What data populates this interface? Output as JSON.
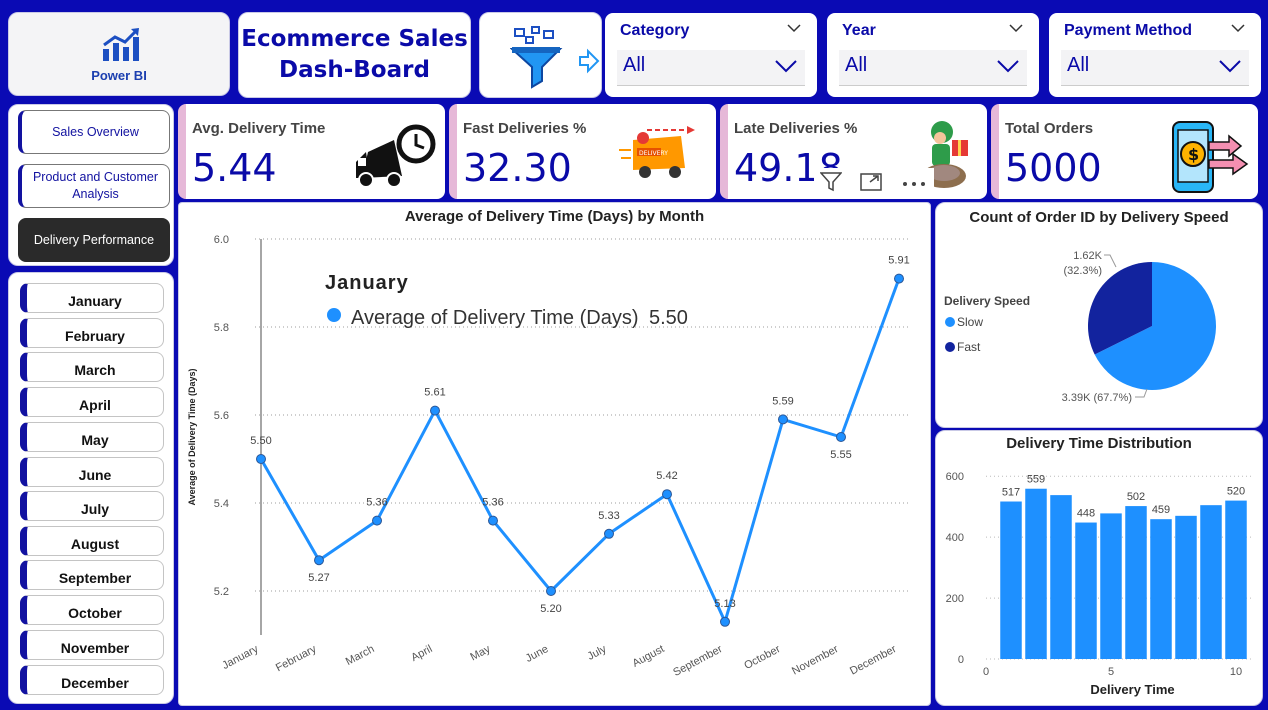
{
  "app": {
    "logo_text": "Power BI",
    "title_line1": "Ecommerce Sales",
    "title_line2": "Dash-Board"
  },
  "slicers": [
    {
      "label": "Category",
      "value": "All"
    },
    {
      "label": "Year",
      "value": "All"
    },
    {
      "label": "Payment Method",
      "value": "All"
    }
  ],
  "nav": [
    {
      "label": "Sales Overview"
    },
    {
      "label": "Product and Customer Analysis"
    },
    {
      "label": "Delivery Performance"
    }
  ],
  "months": [
    "January",
    "February",
    "March",
    "April",
    "May",
    "June",
    "July",
    "August",
    "September",
    "October",
    "November",
    "December"
  ],
  "kpis": [
    {
      "title": "Avg. Delivery Time",
      "value": "5.44",
      "icon": "truck-clock-icon"
    },
    {
      "title": "Fast Deliveries %",
      "value": "32.30",
      "icon": "delivery-van-icon"
    },
    {
      "title": "Late Deliveries %",
      "value": "49.18",
      "icon": "turtle-courier-icon"
    },
    {
      "title": "Total Orders",
      "value": "5000",
      "icon": "phone-payment-icon"
    }
  ],
  "tooltip": {
    "month": "January",
    "series": "Average of Delivery Time (Days)",
    "value": "5.50"
  },
  "chart_data": [
    {
      "type": "line",
      "title": "Average of Delivery Time (Days) by Month",
      "xlabel": "",
      "ylabel": "Average of Delivery Time (Days)",
      "categories": [
        "January",
        "February",
        "March",
        "April",
        "May",
        "June",
        "July",
        "August",
        "September",
        "October",
        "November",
        "December"
      ],
      "values": [
        5.5,
        5.27,
        5.36,
        5.61,
        5.36,
        5.2,
        5.33,
        5.42,
        5.13,
        5.59,
        5.55,
        5.91
      ],
      "labels": [
        "5.50",
        "5.27",
        "5.36",
        "5.61",
        "5.36",
        "5.20",
        "5.33",
        "5.42",
        "5.13",
        "5.59",
        "5.55",
        "5.91"
      ],
      "ylim": [
        5.1,
        6.0
      ],
      "yticks": [
        "5.2",
        "5.4",
        "5.6",
        "5.8",
        "6.0"
      ],
      "ytick_values": [
        5.2,
        5.4,
        5.6,
        5.8,
        6.0
      ],
      "color": "#1e90ff",
      "grid": true
    },
    {
      "type": "pie",
      "title": "Count of Order ID by Delivery Speed",
      "legend_title": "Delivery Speed",
      "slices": [
        {
          "name": "Slow",
          "value": 3390,
          "label": "3.39K (67.7%)",
          "color": "#1e90ff"
        },
        {
          "name": "Fast",
          "value": 1620,
          "label": "1.62K (32.3%)",
          "color": "#12239e"
        }
      ],
      "legend_position": "left"
    },
    {
      "type": "bar",
      "title": "Delivery Time Distribution",
      "xlabel": "Delivery Time",
      "ylabel": "",
      "x": [
        1,
        2,
        3,
        4,
        5,
        6,
        7,
        8,
        9,
        10
      ],
      "values": [
        517,
        559,
        538,
        448,
        478,
        502,
        459,
        470,
        505,
        520
      ],
      "labels": [
        "517",
        "559",
        "",
        "448",
        "",
        "502",
        "459",
        "",
        "",
        "520"
      ],
      "ylim": [
        0,
        650
      ],
      "yticks": [
        "0",
        "200",
        "400",
        "600"
      ],
      "ytick_values": [
        0,
        200,
        400,
        600
      ],
      "xticks": [
        "0",
        "5",
        "10"
      ],
      "xtick_values": [
        0,
        5,
        10
      ],
      "color": "#1e90ff"
    }
  ]
}
